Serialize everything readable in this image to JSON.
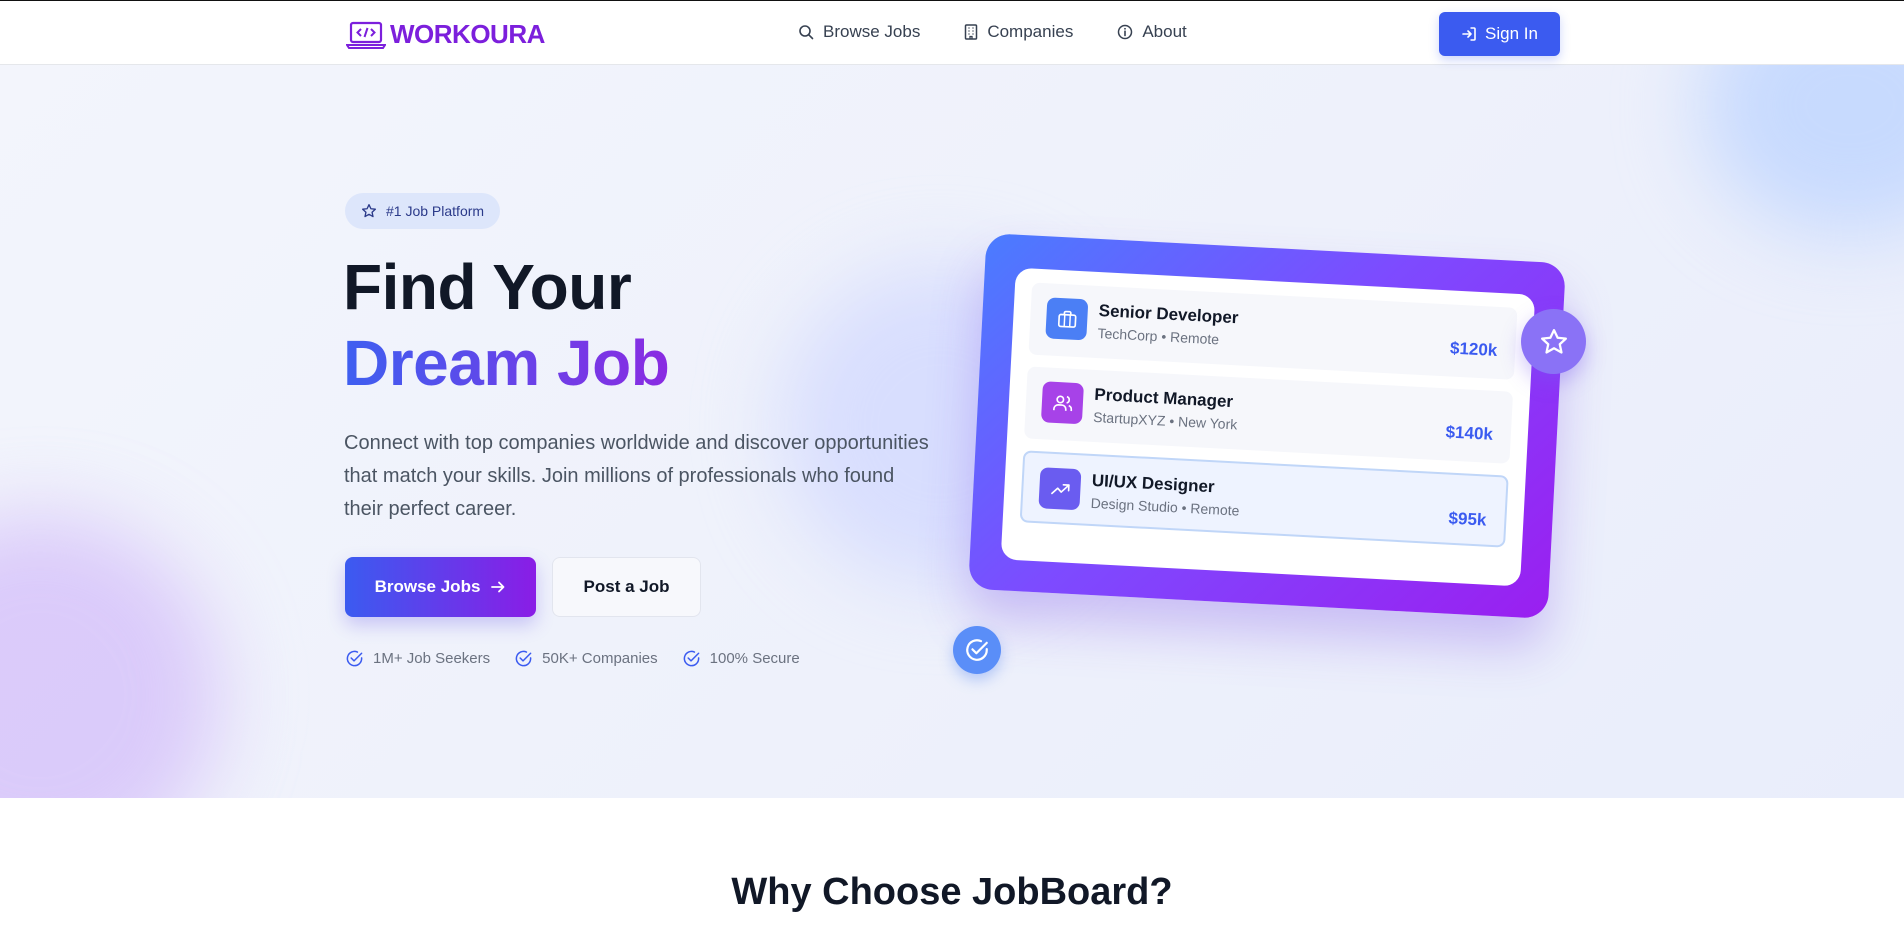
{
  "navbar": {
    "logo_text": "WORKOURA",
    "links": [
      {
        "label": "Browse Jobs",
        "icon": "search-icon"
      },
      {
        "label": "Companies",
        "icon": "building-icon"
      },
      {
        "label": "About",
        "icon": "info-icon"
      }
    ],
    "signin_label": "Sign In"
  },
  "hero": {
    "badge": "#1 Job Platform",
    "title_line1": "Find Your",
    "title_line2": "Dream Job",
    "description": "Connect with top companies worldwide and discover opportunities that match your skills. Join millions of professionals who found their perfect career.",
    "primary_button": "Browse Jobs",
    "secondary_button": "Post a Job",
    "stats": [
      "1M+ Job Seekers",
      "50K+ Companies",
      "100% Secure"
    ]
  },
  "job_card": {
    "jobs": [
      {
        "title": "Senior Developer",
        "subtitle": "TechCorp • Remote",
        "salary": "$120k",
        "icon": "briefcase-icon",
        "color": "#4b7ff5"
      },
      {
        "title": "Product Manager",
        "subtitle": "StartupXYZ • New York",
        "salary": "$140k",
        "icon": "users-icon",
        "color": "#a742e8"
      },
      {
        "title": "UI/UX Designer",
        "subtitle": "Design Studio • Remote",
        "salary": "$95k",
        "icon": "trending-up-icon",
        "color": "#6a5cf0"
      }
    ]
  },
  "features": {
    "title": "Why Choose JobBoard?"
  },
  "colors": {
    "brand": "#7c1fdc",
    "primary": "#3b5bf0",
    "accent": "#8a2be2"
  }
}
